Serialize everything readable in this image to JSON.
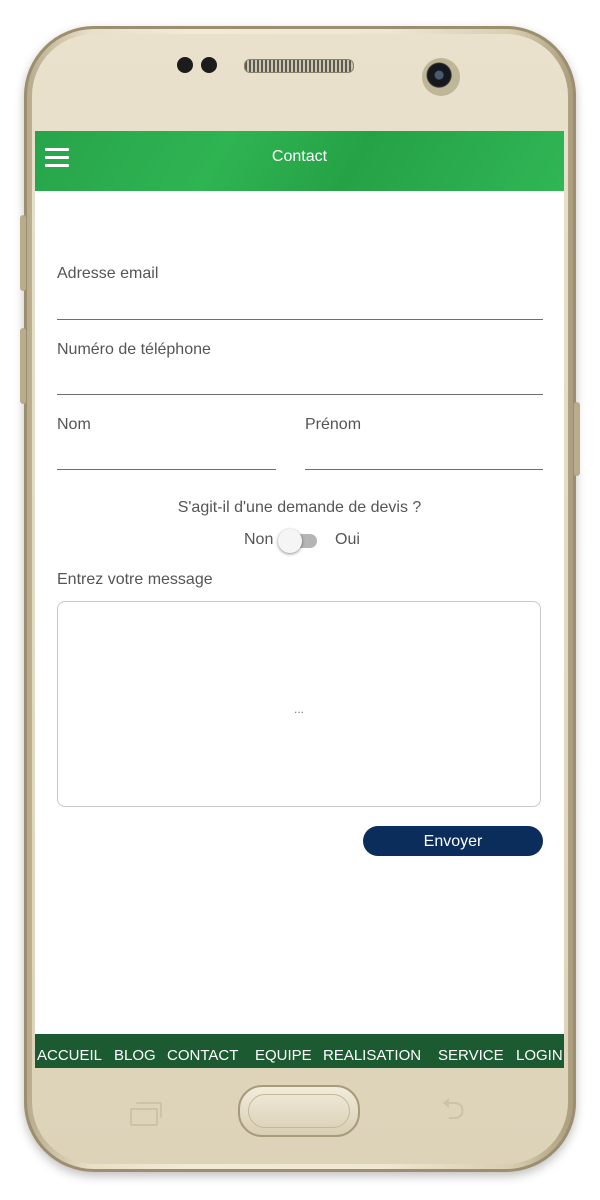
{
  "app": {
    "title": "Contact",
    "accent_color": "#2eb050",
    "nav_color": "#1c5a32",
    "button_color": "#0b2d5b"
  },
  "topbar": {
    "menu_icon": "hamburger-menu-icon"
  },
  "form": {
    "email_label": "Adresse email",
    "email_value": "",
    "phone_label": "Numéro de téléphone",
    "phone_value": "",
    "last_name_label": "Nom",
    "last_name_value": "",
    "first_name_label": "Prénom",
    "first_name_value": "",
    "quote_question": "S'agit-il d'une demande de devis ?",
    "toggle_off_label": "Non",
    "toggle_on_label": "Oui",
    "toggle_state": "off",
    "message_label": "Entrez votre message",
    "message_placeholder": "...",
    "send_label": "Envoyer"
  },
  "bottom_nav": {
    "items": [
      {
        "label": "ACCUEIL"
      },
      {
        "label": "BLOG"
      },
      {
        "label": "CONTACT"
      },
      {
        "label": "EQUIPE"
      },
      {
        "label": "REALISATION"
      },
      {
        "label": "SERVICE"
      },
      {
        "label": "LOGIN"
      }
    ]
  },
  "device": {
    "recents_icon": "recents-icon",
    "home_icon": "home-button",
    "back_icon": "back-icon"
  }
}
